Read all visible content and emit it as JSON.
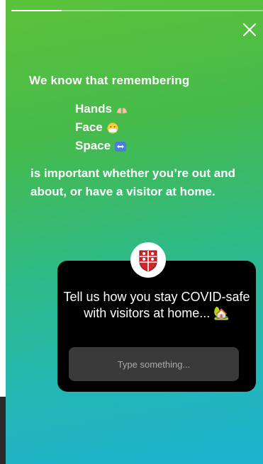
{
  "story": {
    "progress_fraction": 0.2,
    "close_icon": "close-icon",
    "intro_text": "We know that remembering",
    "list": [
      {
        "label": "Hands",
        "icon": "hands-emoji-icon"
      },
      {
        "label": "Face",
        "icon": "mask-face-emoji-icon"
      },
      {
        "label": "Space",
        "icon": "left-right-arrow-emoji-icon"
      }
    ],
    "body_text": "is important whether you’re out and about, or have a visitor at home."
  },
  "question_sticker": {
    "avatar_icon": "organization-crest-avatar",
    "question": "Tell us how you stay COVID-safe with visitors at home... 🏡",
    "input_placeholder": "Type something..."
  },
  "colors": {
    "gradient_top": "#5cc23a",
    "gradient_bottom": "#1fb0d0",
    "card": "#000000",
    "input": "#3a3a3a"
  }
}
